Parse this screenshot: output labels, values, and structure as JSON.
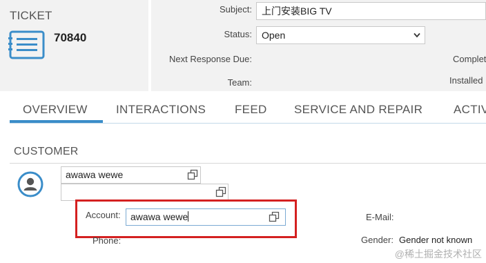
{
  "header": {
    "ticket_label": "TICKET",
    "ticket_number": "70840",
    "subject_label": "Subject:",
    "subject_value": "上门安装BIG TV",
    "status_label": "Status:",
    "status_value": "Open",
    "next_response_label": "Next Response Due:",
    "team_label": "Team:",
    "right_col_1": "Complet",
    "right_col_2": "Installed"
  },
  "tabs": [
    {
      "label": "OVERVIEW"
    },
    {
      "label": "INTERACTIONS"
    },
    {
      "label": "FEED"
    },
    {
      "label": "SERVICE AND REPAIR"
    },
    {
      "label": "ACTIV"
    }
  ],
  "customer": {
    "section_title": "CUSTOMER",
    "name_value": "awawa wewe",
    "second_value": "",
    "account_label": "Account:",
    "account_value": "awawa wewe",
    "email_label": "E-Mail:",
    "phone_label": "Phone:",
    "gender_label": "Gender:",
    "gender_value": "Gender not known"
  },
  "watermark": "@稀土掘金技术社区",
  "colors": {
    "accent": "#3a8dc9",
    "highlight": "#d42020",
    "header_bg": "#f2f2f2"
  },
  "icons": {
    "ticket": "ticket-icon",
    "avatar": "person-avatar-icon",
    "copy": "open-in-new-icon",
    "select": "chevron-down-icon"
  }
}
